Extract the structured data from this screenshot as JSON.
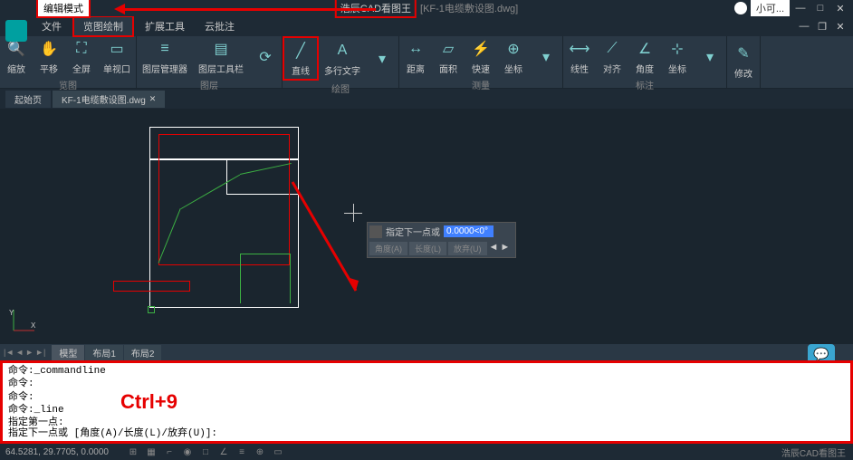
{
  "titlebar": {
    "mode": "编辑模式",
    "app_name": "浩辰CAD看图王",
    "doc_name": "[KF-1电缆敷设图.dwg]",
    "user": "小可..."
  },
  "menus": [
    "文件",
    "览图绘制",
    "扩展工具",
    "云批注"
  ],
  "ribbon": {
    "groups": [
      {
        "name": "览图",
        "items": [
          {
            "label": "缩放",
            "icon": "🔍"
          },
          {
            "label": "平移",
            "icon": "✋"
          },
          {
            "label": "全屏",
            "icon": "⛶"
          },
          {
            "label": "单视口",
            "icon": "▭"
          }
        ]
      },
      {
        "name": "图层",
        "items": [
          {
            "label": "图层管理器",
            "icon": "≡"
          },
          {
            "label": "图层工具栏",
            "icon": "▤"
          },
          {
            "label": "",
            "icon": "⟳"
          }
        ]
      },
      {
        "name": "绘图",
        "items": [
          {
            "label": "直线",
            "icon": "╱",
            "hl": true
          },
          {
            "label": "多行文字",
            "icon": "A"
          },
          {
            "label": "",
            "icon": "▾"
          }
        ]
      },
      {
        "name": "测量",
        "items": [
          {
            "label": "距离",
            "icon": "↔"
          },
          {
            "label": "面积",
            "icon": "▱"
          },
          {
            "label": "快速",
            "icon": "⚡"
          },
          {
            "label": "坐标",
            "icon": "⊕"
          },
          {
            "label": "",
            "icon": "▾"
          }
        ]
      },
      {
        "name": "标注",
        "items": [
          {
            "label": "线性",
            "icon": "⟷"
          },
          {
            "label": "对齐",
            "icon": "⟋"
          },
          {
            "label": "角度",
            "icon": "∠"
          },
          {
            "label": "坐标",
            "icon": "⊹"
          },
          {
            "label": "",
            "icon": "▾"
          }
        ]
      },
      {
        "name": "",
        "items": [
          {
            "label": "修改",
            "icon": "✎"
          }
        ]
      }
    ]
  },
  "doc_tabs": [
    {
      "label": "起始页"
    },
    {
      "label": "KF-1电缆敷设图.dwg",
      "active": true
    }
  ],
  "input_popup": {
    "prompt": "指定下一点或",
    "value": "0.0000<0°",
    "opts": [
      "角度(A)",
      "长度(L)",
      "放弃(U)"
    ]
  },
  "layout_tabs": [
    "模型",
    "布局1",
    "布局2"
  ],
  "cmdline": {
    "lines": [
      "命令:_commandline",
      "命令:",
      "命令:",
      "命令:_line",
      "指定第一点:"
    ],
    "input_prompt": "指定下一点或 [角度(A)/长度(L)/放弃(U)]:",
    "overlay": "Ctrl+9"
  },
  "status": {
    "coords": "64.5281, 29.7705, 0.0000",
    "brand": "浩辰CAD看图王"
  },
  "help_label": "协作"
}
